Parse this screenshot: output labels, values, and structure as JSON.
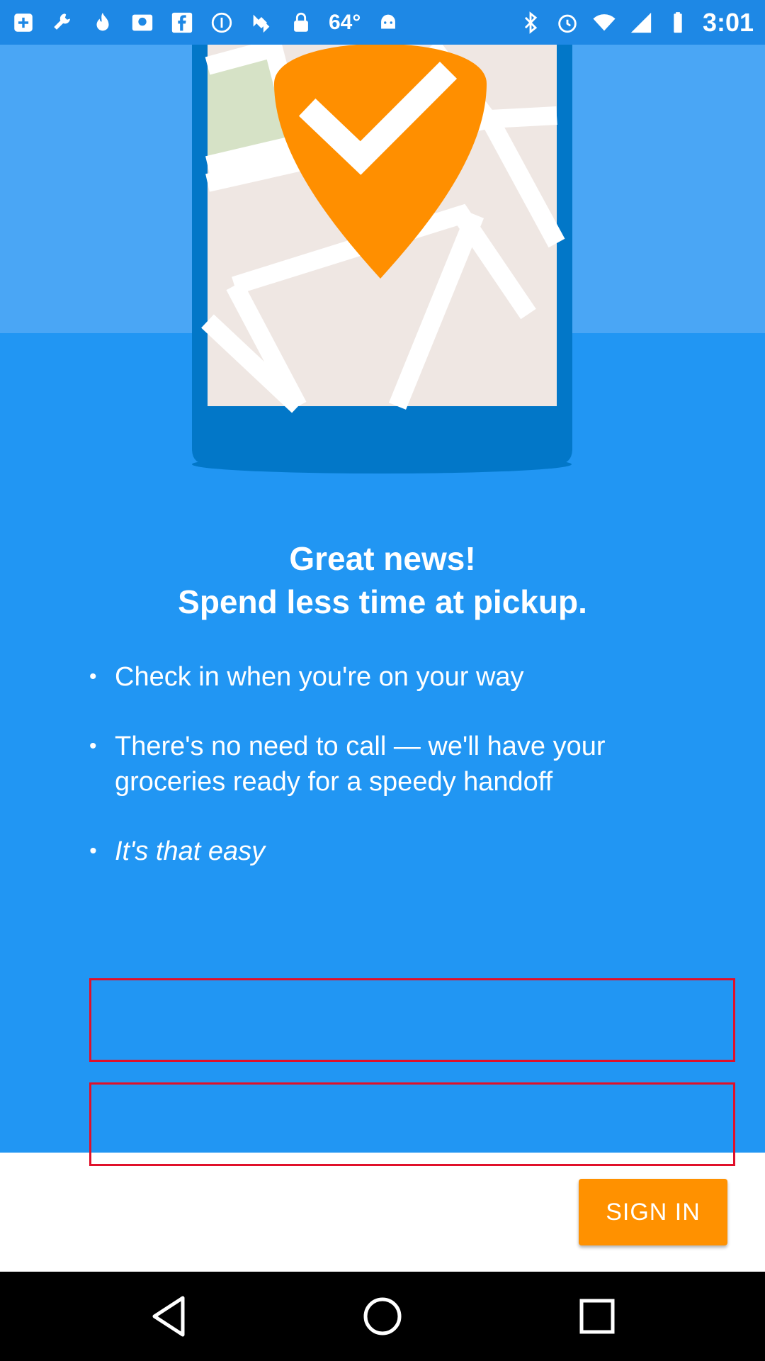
{
  "status_bar": {
    "temperature": "64°",
    "time": "3:01",
    "left_icons": [
      "calendar-plus-icon",
      "wrench-icon",
      "flame-icon",
      "photo-card-icon",
      "facebook-icon",
      "info-icon",
      "fake-gps-satellite-icon",
      "lock-icon"
    ],
    "right_icons": [
      "android-icon",
      "bluetooth-icon",
      "alarm-icon",
      "wifi-icon",
      "signal-icon",
      "battery-icon"
    ]
  },
  "hero": {
    "illustration": "phone-map-checkmark-pin",
    "colors": {
      "pin": "#ff8f00",
      "phone": "#0277c8",
      "map": "#efe7e3",
      "park": "#d6e2c6"
    }
  },
  "headline": {
    "line1": "Great news!",
    "line2": "Spend less time at pickup."
  },
  "bullets": {
    "item1": "Check in when you're on your way",
    "item2": "There's no need to call — we'll have your groceries ready for a speedy handoff",
    "item3": "It's that easy"
  },
  "actions": {
    "sign_in_label": "SIGN IN"
  },
  "colors": {
    "background": "#2196f3",
    "accent": "#ff9100",
    "highlight_border": "#e0102a"
  },
  "nav_bar": {
    "buttons": [
      "back-icon",
      "home-icon",
      "recent-apps-icon"
    ]
  }
}
